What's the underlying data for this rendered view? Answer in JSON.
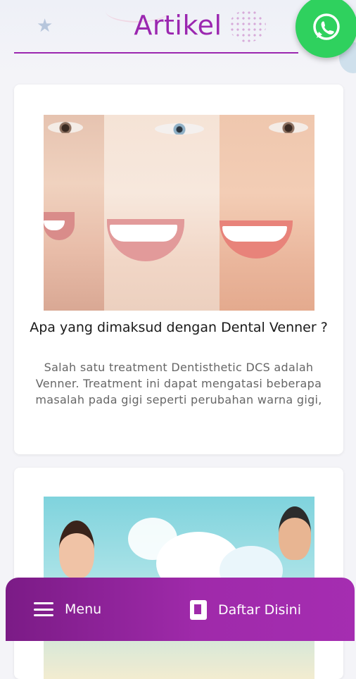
{
  "header": {
    "title": "Artikel"
  },
  "floating": {
    "whatsapp_icon": "whatsapp-icon"
  },
  "articles": [
    {
      "title": "Apa yang dimaksud dengan Dental Venner ?",
      "excerpt": "Salah satu treatment Dentisthetic DCS adalah Venner. Treatment ini dapat mengatasi beberapa masalah pada gigi seperti perubahan warna gigi,"
    }
  ],
  "bottom_nav": {
    "menu_label": "Menu",
    "menu_icon": "hamburger-icon",
    "register_label": "Daftar Disini",
    "register_icon": "book-icon"
  },
  "colors": {
    "accent": "#9b27b0",
    "whatsapp": "#2fd15e",
    "bottom_bar": "#9f2aaa"
  }
}
